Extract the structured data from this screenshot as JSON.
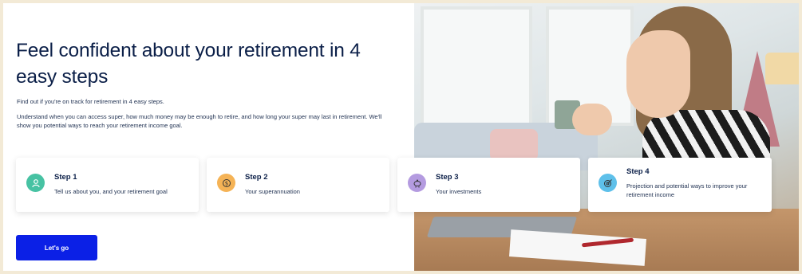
{
  "hero": {
    "title": "Feel confident about your retirement in 4 easy steps",
    "intro": "Find out if you're on track for retirement in 4 easy steps.",
    "description": "Understand when you can access super, how much money may be enough to retire, and how long your super may last in retirement. We'll show you potential ways to reach your retirement income goal."
  },
  "steps": [
    {
      "label": "Step 1",
      "text": "Tell us about you, and your retirement goal",
      "icon": "person-icon",
      "color": "#47c2a3"
    },
    {
      "label": "Step 2",
      "text": "Your superannuation",
      "icon": "dollar-coin-icon",
      "color": "#f5b356"
    },
    {
      "label": "Step 3",
      "text": "Your investments",
      "icon": "piggy-bank-icon",
      "color": "#b49be0"
    },
    {
      "label": "Step 4",
      "text": "Projection and potential ways to improve your retirement income",
      "icon": "target-icon",
      "color": "#5ec0ea"
    }
  ],
  "cta": {
    "label": "Let's go",
    "color": "#0b20e6"
  }
}
